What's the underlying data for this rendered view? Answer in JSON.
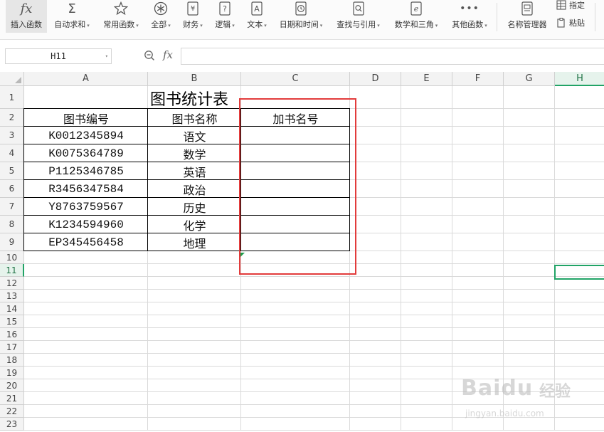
{
  "ribbon": {
    "buttons": [
      {
        "label": "插入函数",
        "icon": "function-icon",
        "dropdown": false
      },
      {
        "label": "自动求和",
        "icon": "sigma-icon",
        "dropdown": true
      },
      {
        "label": "常用函数",
        "icon": "star-icon",
        "dropdown": true
      },
      {
        "label": "全部",
        "icon": "asterisk-circle-icon",
        "dropdown": true
      },
      {
        "label": "财务",
        "icon": "yen-icon",
        "dropdown": true
      },
      {
        "label": "逻辑",
        "icon": "question-icon",
        "dropdown": true
      },
      {
        "label": "文本",
        "icon": "text-a-icon",
        "dropdown": true
      },
      {
        "label": "日期和时间",
        "icon": "clock-icon",
        "dropdown": true
      },
      {
        "label": "查找与引用",
        "icon": "magnifier-icon",
        "dropdown": true
      },
      {
        "label": "数学和三角",
        "icon": "theta-icon",
        "dropdown": true
      },
      {
        "label": "其他函数",
        "icon": "more-dots-icon",
        "dropdown": true
      },
      {
        "label": "名称管理器",
        "icon": "name-manager-icon",
        "dropdown": false
      }
    ],
    "side_items": [
      {
        "label": "指定",
        "icon": "table-icon"
      },
      {
        "label": "粘贴",
        "icon": "paste-icon"
      }
    ]
  },
  "formula_bar": {
    "name_box": "H11",
    "fx_label": "fx",
    "formula": ""
  },
  "grid": {
    "columns": [
      "A",
      "B",
      "C",
      "D",
      "E",
      "F",
      "G",
      "H"
    ],
    "selected_column": "H",
    "rows": [
      "1",
      "2",
      "3",
      "4",
      "5",
      "6",
      "7",
      "8",
      "9",
      "10",
      "11",
      "12",
      "13",
      "14",
      "15",
      "16",
      "17",
      "18",
      "19",
      "20",
      "21",
      "22",
      "23"
    ],
    "selected_row": "11",
    "active_cell": "H11"
  },
  "table": {
    "title": "图书统计表",
    "headers": [
      "图书编号",
      "图书名称",
      "加书名号"
    ],
    "rows": [
      {
        "code": "K0012345894",
        "name": "语文",
        "marked": ""
      },
      {
        "code": "K0075364789",
        "name": "数学",
        "marked": ""
      },
      {
        "code": "P1125346785",
        "name": "英语",
        "marked": ""
      },
      {
        "code": "R3456347584",
        "name": "政治",
        "marked": ""
      },
      {
        "code": "Y8763759567",
        "name": "历史",
        "marked": ""
      },
      {
        "code": "K1234594960",
        "name": "化学",
        "marked": ""
      },
      {
        "code": "EP345456458",
        "name": "地理",
        "marked": ""
      }
    ]
  },
  "watermark": {
    "brand": "Baidu",
    "product": "经验",
    "url": "jingyan.baidu.com"
  },
  "colors": {
    "highlight_box": "#e23b3b",
    "selection_green": "#21a366"
  }
}
